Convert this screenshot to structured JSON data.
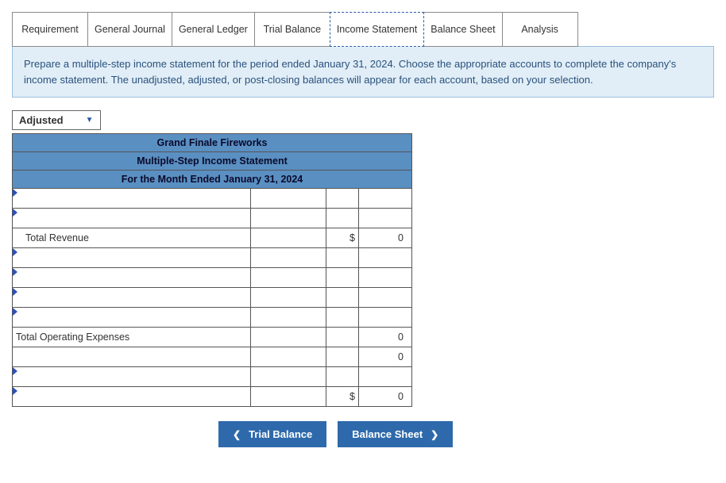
{
  "tabs": [
    {
      "label": "Requirement"
    },
    {
      "label": "General Journal"
    },
    {
      "label": "General Ledger"
    },
    {
      "label": "Trial Balance"
    },
    {
      "label": "Income Statement"
    },
    {
      "label": "Balance Sheet"
    },
    {
      "label": "Analysis"
    }
  ],
  "instruction": "Prepare a multiple-step income statement for the period ended January 31, 2024. Choose the appropriate accounts to complete the company's income statement. The unadjusted, adjusted, or post-closing balances will appear for each account, based on your selection.",
  "dropdown": {
    "value": "Adjusted"
  },
  "statement": {
    "header1": "Grand Finale Fireworks",
    "header2": "Multiple-Step Income Statement",
    "header3": "For the Month Ended January 31, 2024",
    "rows": [
      {
        "label": "",
        "sym": "",
        "val": "",
        "tri": true
      },
      {
        "label": "",
        "sym": "",
        "val": "",
        "tri": true
      },
      {
        "label": "Total Revenue",
        "sym": "$",
        "val": "0",
        "tri": false,
        "indent": true
      },
      {
        "label": "",
        "sym": "",
        "val": "",
        "tri": true
      },
      {
        "label": "",
        "sym": "",
        "val": "",
        "tri": true
      },
      {
        "label": "",
        "sym": "",
        "val": "",
        "tri": true
      },
      {
        "label": "",
        "sym": "",
        "val": "",
        "tri": true
      },
      {
        "label": "Total Operating Expenses",
        "sym": "",
        "val": "0",
        "tri": false
      },
      {
        "label": "",
        "sym": "",
        "val": "0",
        "tri": false
      },
      {
        "label": "",
        "sym": "",
        "val": "",
        "tri": true
      },
      {
        "label": "",
        "sym": "$",
        "val": "0",
        "tri": true
      }
    ]
  },
  "nav": {
    "prev": "Trial Balance",
    "next": "Balance Sheet"
  }
}
